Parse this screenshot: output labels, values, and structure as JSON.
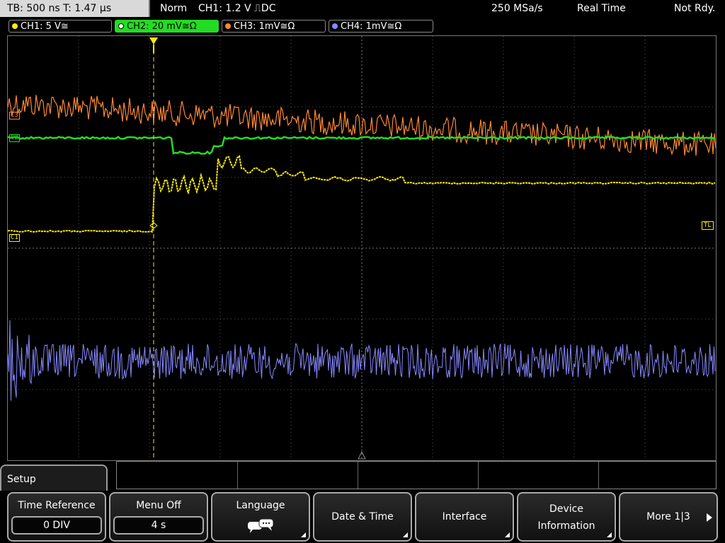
{
  "status": {
    "timebase": "TB: 500 ns   T: 1.47 µs",
    "mode": "Norm",
    "trigger": "CH1: 1.2 V ⎍DC",
    "sample_rate": "250 MSa/s",
    "acq_mode": "Real Time",
    "state": "Not Rdy."
  },
  "channels": [
    {
      "label": "CH1: 5 V≅",
      "color": "#ffee00",
      "active": false
    },
    {
      "label": "CH2: 20 mV≅Ω",
      "color": "#22dd22",
      "active": true
    },
    {
      "label": "CH3: 1mV≅Ω",
      "color": "#ff8833",
      "active": false
    },
    {
      "label": "CH4: 1mV≅Ω",
      "color": "#8888ff",
      "active": false
    }
  ],
  "markers": {
    "c1": "C1",
    "c2": "C2",
    "c3": "C3",
    "tl": "TL"
  },
  "menu": {
    "title": "Setup",
    "softkeys": [
      {
        "label": "Time Reference",
        "value": "0 DIV"
      },
      {
        "label": "Menu Off",
        "value": "4 s"
      },
      {
        "label": "Language",
        "icon": "speech-bubbles-icon"
      },
      {
        "label": "Date & Time"
      },
      {
        "label": "Interface"
      },
      {
        "label_line1": "Device",
        "label_line2": "Information"
      },
      {
        "label": "More 1|3"
      }
    ]
  },
  "colors": {
    "ch1": "#ffee00",
    "ch2": "#22dd22",
    "ch3": "#ff8833",
    "ch4": "#8888ff",
    "grid": "#555555"
  }
}
